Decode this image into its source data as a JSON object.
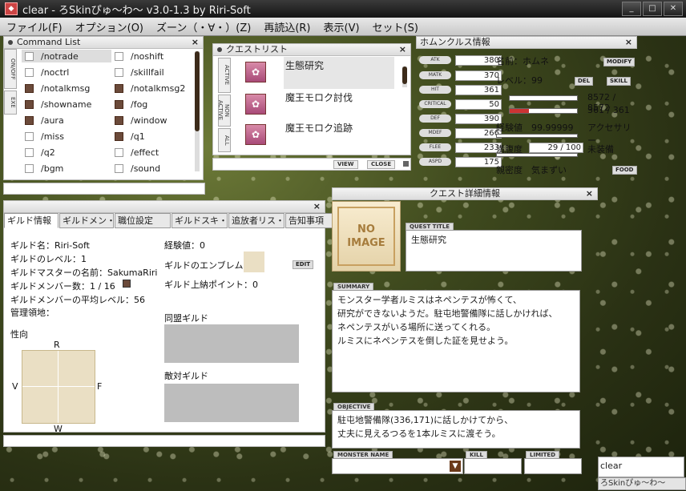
{
  "app": {
    "title": "clear - ろSkinぴゅ～わ～ v3.0-1.3 by Riri-Soft",
    "icon": "app-icon"
  },
  "menu": {
    "items": [
      "ファイル(F)",
      "オプション(O)",
      "ズーン（・∀・）(Z)",
      "再読込(R)",
      "表示(V)",
      "セット(S)"
    ]
  },
  "command_list": {
    "title": "Command List",
    "tabs": [
      "ON/OFF",
      "EXE"
    ],
    "items": [
      {
        "label": "/notrade",
        "checked": false
      },
      {
        "label": "/noshift",
        "checked": false
      },
      {
        "label": "/noctrl",
        "checked": false
      },
      {
        "label": "/skillfail",
        "checked": false
      },
      {
        "label": "/notalkmsg",
        "checked": true
      },
      {
        "label": "/notalkmsg2",
        "checked": true
      },
      {
        "label": "/showname",
        "checked": true
      },
      {
        "label": "/fog",
        "checked": true
      },
      {
        "label": "/aura",
        "checked": true
      },
      {
        "label": "/window",
        "checked": true
      },
      {
        "label": "/miss",
        "checked": false
      },
      {
        "label": "/q1",
        "checked": true
      },
      {
        "label": "/q2",
        "checked": false
      },
      {
        "label": "/effect",
        "checked": false
      },
      {
        "label": "/bgm",
        "checked": false
      },
      {
        "label": "/sound",
        "checked": false
      }
    ]
  },
  "quest_list": {
    "title": "クエストリスト",
    "tabs": [
      "ACTIVE",
      "NON ACTIVE",
      "ALL"
    ],
    "items": [
      "生態研究",
      "魔王モロク討伐",
      "魔王モロク追跡"
    ],
    "view_label": "VIEW",
    "close_label": "CLOSE"
  },
  "homunculus": {
    "title": "ホムンクルス情報",
    "stats": [
      {
        "label": "ATK",
        "value": "380"
      },
      {
        "label": "MATK",
        "value": "370"
      },
      {
        "label": "HIT",
        "value": "361"
      },
      {
        "label": "CRITICAL",
        "value": "50"
      },
      {
        "label": "DEF",
        "value": "390"
      },
      {
        "label": "MDEF",
        "value": "266"
      },
      {
        "label": "FLEE",
        "value": "233"
      },
      {
        "label": "ASPD",
        "value": "175"
      }
    ],
    "name_label": "名前：ホムネ",
    "level_label": "レベル：99",
    "hp_text": "8572 / 8572",
    "sp_text": "361 / 361",
    "exp_text": "経験値　99.99999",
    "exp_suffix": "アクセサリー",
    "hunger_label": "満腹度",
    "hunger_value": "29 / 100",
    "equip_label": "未装備",
    "intimacy": "親密度　気まずい",
    "buttons": {
      "modify": "MODIFY",
      "del": "DEL",
      "skill": "SKILL",
      "food": "FOOD"
    },
    "hp_fraction": 1.0,
    "sp_fraction": 0.28
  },
  "guild": {
    "tabs": [
      "ギルド情報",
      "ギルドメン・",
      "職位設定",
      "ギルドスキ・",
      "追放者リス・",
      "告知事項"
    ],
    "name": "ギルド名：Riri-Soft",
    "level": "ギルドのレベル：1",
    "master": "ギルドマスターの名前：SakumaRiri",
    "members": "ギルドメンバー数：1 / 16",
    "avg_level": "ギルドメンバーの平均レベル：56",
    "territory": "管理領地：",
    "exp": "経験値：0",
    "emblem": "ギルドのエンブレム",
    "edit": "EDIT",
    "tax": "ギルド上納ポイント：0",
    "alliance": "同盟ギルド",
    "hostile": "敵対ギルド",
    "tendency": "性向",
    "axis": {
      "r": "R",
      "v": "V",
      "f": "F",
      "w": "W"
    }
  },
  "quest_detail": {
    "title": "クエスト詳細情報",
    "no_image": [
      "NO",
      "IMAGE"
    ],
    "quest_title_label": "QUEST TITLE",
    "quest_title": "生態研究",
    "summary_label": "SUMMARY",
    "summary_lines": [
      "モンスター学者ルミスはネペンテスが怖くて、",
      "研究ができないようだ。駐屯地警備隊に話しかければ、",
      "ネペンテスがいる場所に送ってくれる。",
      "ルミスにネペンテスを倒した証を見せよう。"
    ],
    "objective_label": "OBJECTIVE",
    "objective_lines": [
      "駐屯地警備隊(336,171)に話しかけてから、",
      "丈夫に見えるつるを1本ルミスに渡そう。"
    ],
    "monster_name_label": "MONSTER NAME",
    "kill_label": "KILL",
    "limited_label": "LIMITED"
  },
  "chat": {
    "input": "clear",
    "skin_tab": "ろSkinぴゅ～わ～"
  }
}
